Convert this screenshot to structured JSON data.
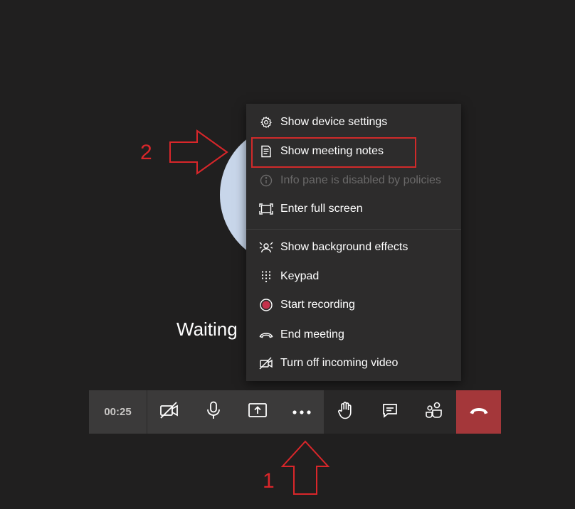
{
  "stage": {
    "waiting_text": "Waiting"
  },
  "menu": {
    "items": [
      {
        "label": "Show device settings",
        "icon": "gear-icon",
        "enabled": true
      },
      {
        "label": "Show meeting notes",
        "icon": "notes-icon",
        "enabled": true
      },
      {
        "label": "Info pane is disabled by policies",
        "icon": "info-icon",
        "enabled": false
      },
      {
        "label": "Enter full screen",
        "icon": "fullscreen-icon",
        "enabled": true
      },
      {
        "label": "Show background effects",
        "icon": "background-effects-icon",
        "enabled": true
      },
      {
        "label": "Keypad",
        "icon": "keypad-icon",
        "enabled": true
      },
      {
        "label": "Start recording",
        "icon": "record-icon",
        "enabled": true
      },
      {
        "label": "End meeting",
        "icon": "end-meeting-icon",
        "enabled": true
      },
      {
        "label": "Turn off incoming video",
        "icon": "video-off-icon",
        "enabled": true
      }
    ]
  },
  "toolbar": {
    "timer": "00:25",
    "buttons": [
      "camera-off-icon",
      "microphone-icon",
      "share-screen-icon",
      "more-options-icon",
      "raise-hand-icon",
      "chat-icon",
      "participants-icon",
      "hang-up-icon"
    ]
  },
  "annotations": {
    "step_1": "1",
    "step_2": "2"
  },
  "colors": {
    "background": "#201f1f",
    "menu_bg": "#2d2c2c",
    "hangup": "#a4373a",
    "annotation": "#d9262a",
    "record_dot": "#c4314b"
  }
}
